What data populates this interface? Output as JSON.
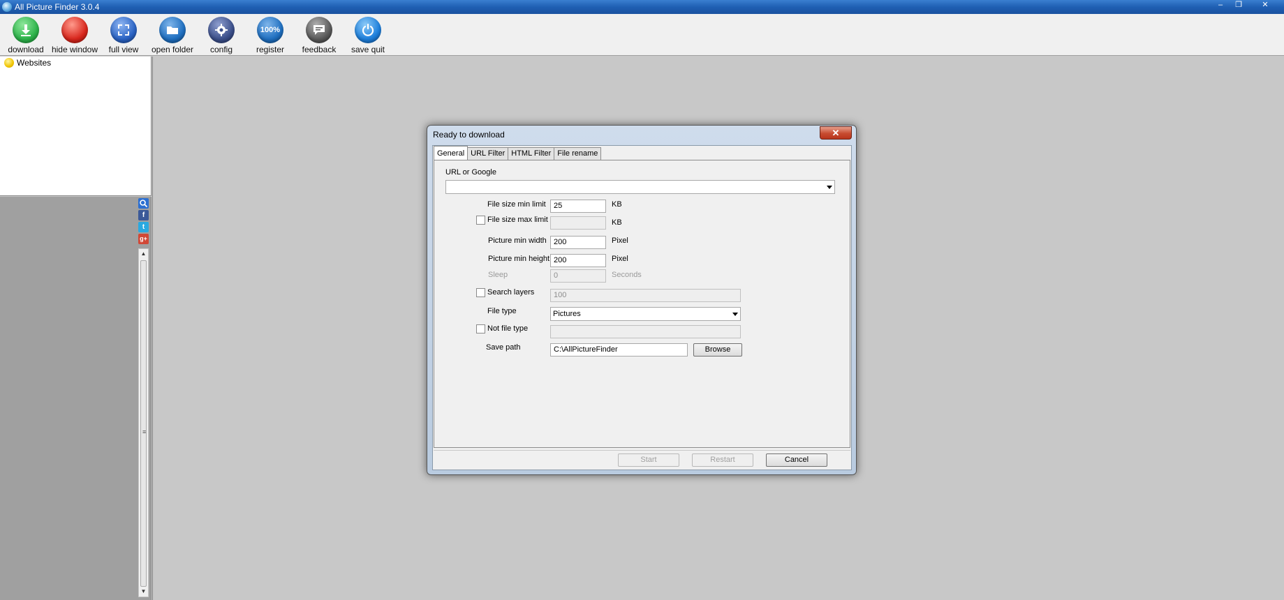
{
  "window": {
    "title": "All Picture Finder 3.0.4",
    "minimize": "‒",
    "restore": "❐",
    "close": "✕"
  },
  "toolbar": {
    "items": [
      {
        "label": "download",
        "icon": "download-icon",
        "color": "#2db34a"
      },
      {
        "label": "hide window",
        "icon": "hide-window-icon",
        "color": "#d8261c"
      },
      {
        "label": "full view",
        "icon": "full-view-icon",
        "color": "#2a63c4"
      },
      {
        "label": "open folder",
        "icon": "folder-icon",
        "color": "#1f6fc0"
      },
      {
        "label": "config",
        "icon": "gear-icon",
        "color": "#3b4f8a"
      },
      {
        "label": "register",
        "icon": "register-icon",
        "color": "#1f6fc0",
        "text": "100%"
      },
      {
        "label": "feedback",
        "icon": "feedback-icon",
        "color": "#5a5a5a"
      },
      {
        "label": "save quit",
        "icon": "power-icon",
        "color": "#1d7fdc"
      }
    ]
  },
  "tree": {
    "root_label": "Websites"
  },
  "social": [
    "search-icon",
    "facebook-icon",
    "twitter-icon",
    "google-plus-icon"
  ],
  "social_glyphs": {
    "facebook": "f",
    "twitter": "t",
    "gplus": "g+"
  },
  "dialog": {
    "title": "Ready to download",
    "close_glyph": "✕",
    "tabs": [
      "General",
      "URL Filter",
      "HTML Filter",
      "File rename"
    ],
    "url_label": "URL or Google",
    "url_value": "",
    "file_size_min": {
      "label": "File size min limit",
      "value": "25",
      "unit": "KB"
    },
    "file_size_max": {
      "label": "File size max limit",
      "value": "",
      "unit": "KB",
      "checked": false
    },
    "min_width": {
      "label": "Picture min width",
      "value": "200",
      "unit": "Pixel"
    },
    "min_height": {
      "label": "Picture min height",
      "value": "200",
      "unit": "Pixel"
    },
    "sleep": {
      "label": "Sleep",
      "value": "0",
      "unit": "Seconds"
    },
    "search_layers": {
      "label": "Search layers",
      "value": "100",
      "checked": false
    },
    "file_type": {
      "label": "File type",
      "value": "Pictures"
    },
    "not_file_type": {
      "label": "Not file type",
      "value": "",
      "checked": false
    },
    "save_path": {
      "label": "Save path",
      "value": "C:\\AllPictureFinder",
      "browse": "Browse"
    },
    "buttons": {
      "start": "Start",
      "restart": "Restart",
      "cancel": "Cancel"
    }
  }
}
